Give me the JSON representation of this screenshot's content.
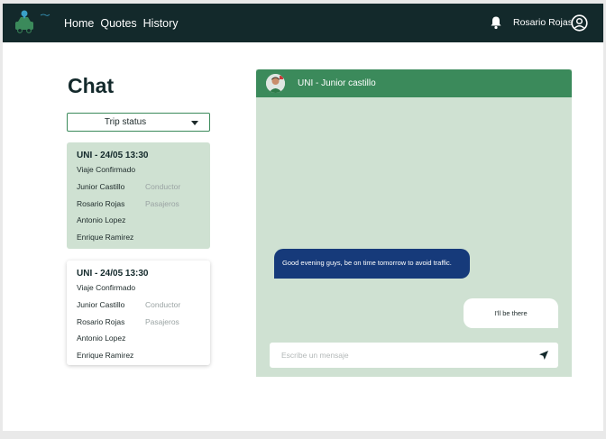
{
  "nav": {
    "items": [
      {
        "label": "Home"
      },
      {
        "label": "Quotes"
      },
      {
        "label": "History"
      }
    ]
  },
  "user": {
    "name": "Rosario Rojas"
  },
  "chat": {
    "title": "Chat",
    "filter": {
      "selected": "Trip status"
    },
    "trips": [
      {
        "title": "UNI - 24/05 13:30",
        "status": "Viaje Confirmado",
        "people": [
          {
            "name": "Junior Castillo",
            "role": "Conductor"
          },
          {
            "name": "Rosario Rojas",
            "role": "Pasajeros"
          },
          {
            "name": "Antonio Lopez",
            "role": ""
          },
          {
            "name": "Enrique Ramirez",
            "role": ""
          }
        ]
      },
      {
        "title": "UNI - 24/05 13:30",
        "status": "Viaje Confirmado",
        "people": [
          {
            "name": "Junior Castillo",
            "role": "Conductor"
          },
          {
            "name": "Rosario Rojas",
            "role": "Pasajeros"
          },
          {
            "name": "Antonio Lopez",
            "role": ""
          },
          {
            "name": "Enrique Ramirez",
            "role": ""
          }
        ]
      }
    ],
    "conversation": {
      "header": "UNI - Junior castillo",
      "messages": [
        {
          "text": "Good evening guys, be on time tomorrow to avoid traffic."
        },
        {
          "text": "I'll be there"
        }
      ],
      "composer": {
        "placeholder": "Escribe un mensaje"
      }
    }
  },
  "colors": {
    "topbar": "#13292b",
    "accent_green": "#3b8a5b",
    "panel_bg": "#cfe1d2",
    "incoming_bubble": "#163a7a"
  },
  "icons": {
    "logo": "car-pin-logo-icon",
    "notifications": "bell-icon",
    "account": "user-circle-icon",
    "dropdown": "caret-down-icon",
    "send": "send-icon"
  }
}
